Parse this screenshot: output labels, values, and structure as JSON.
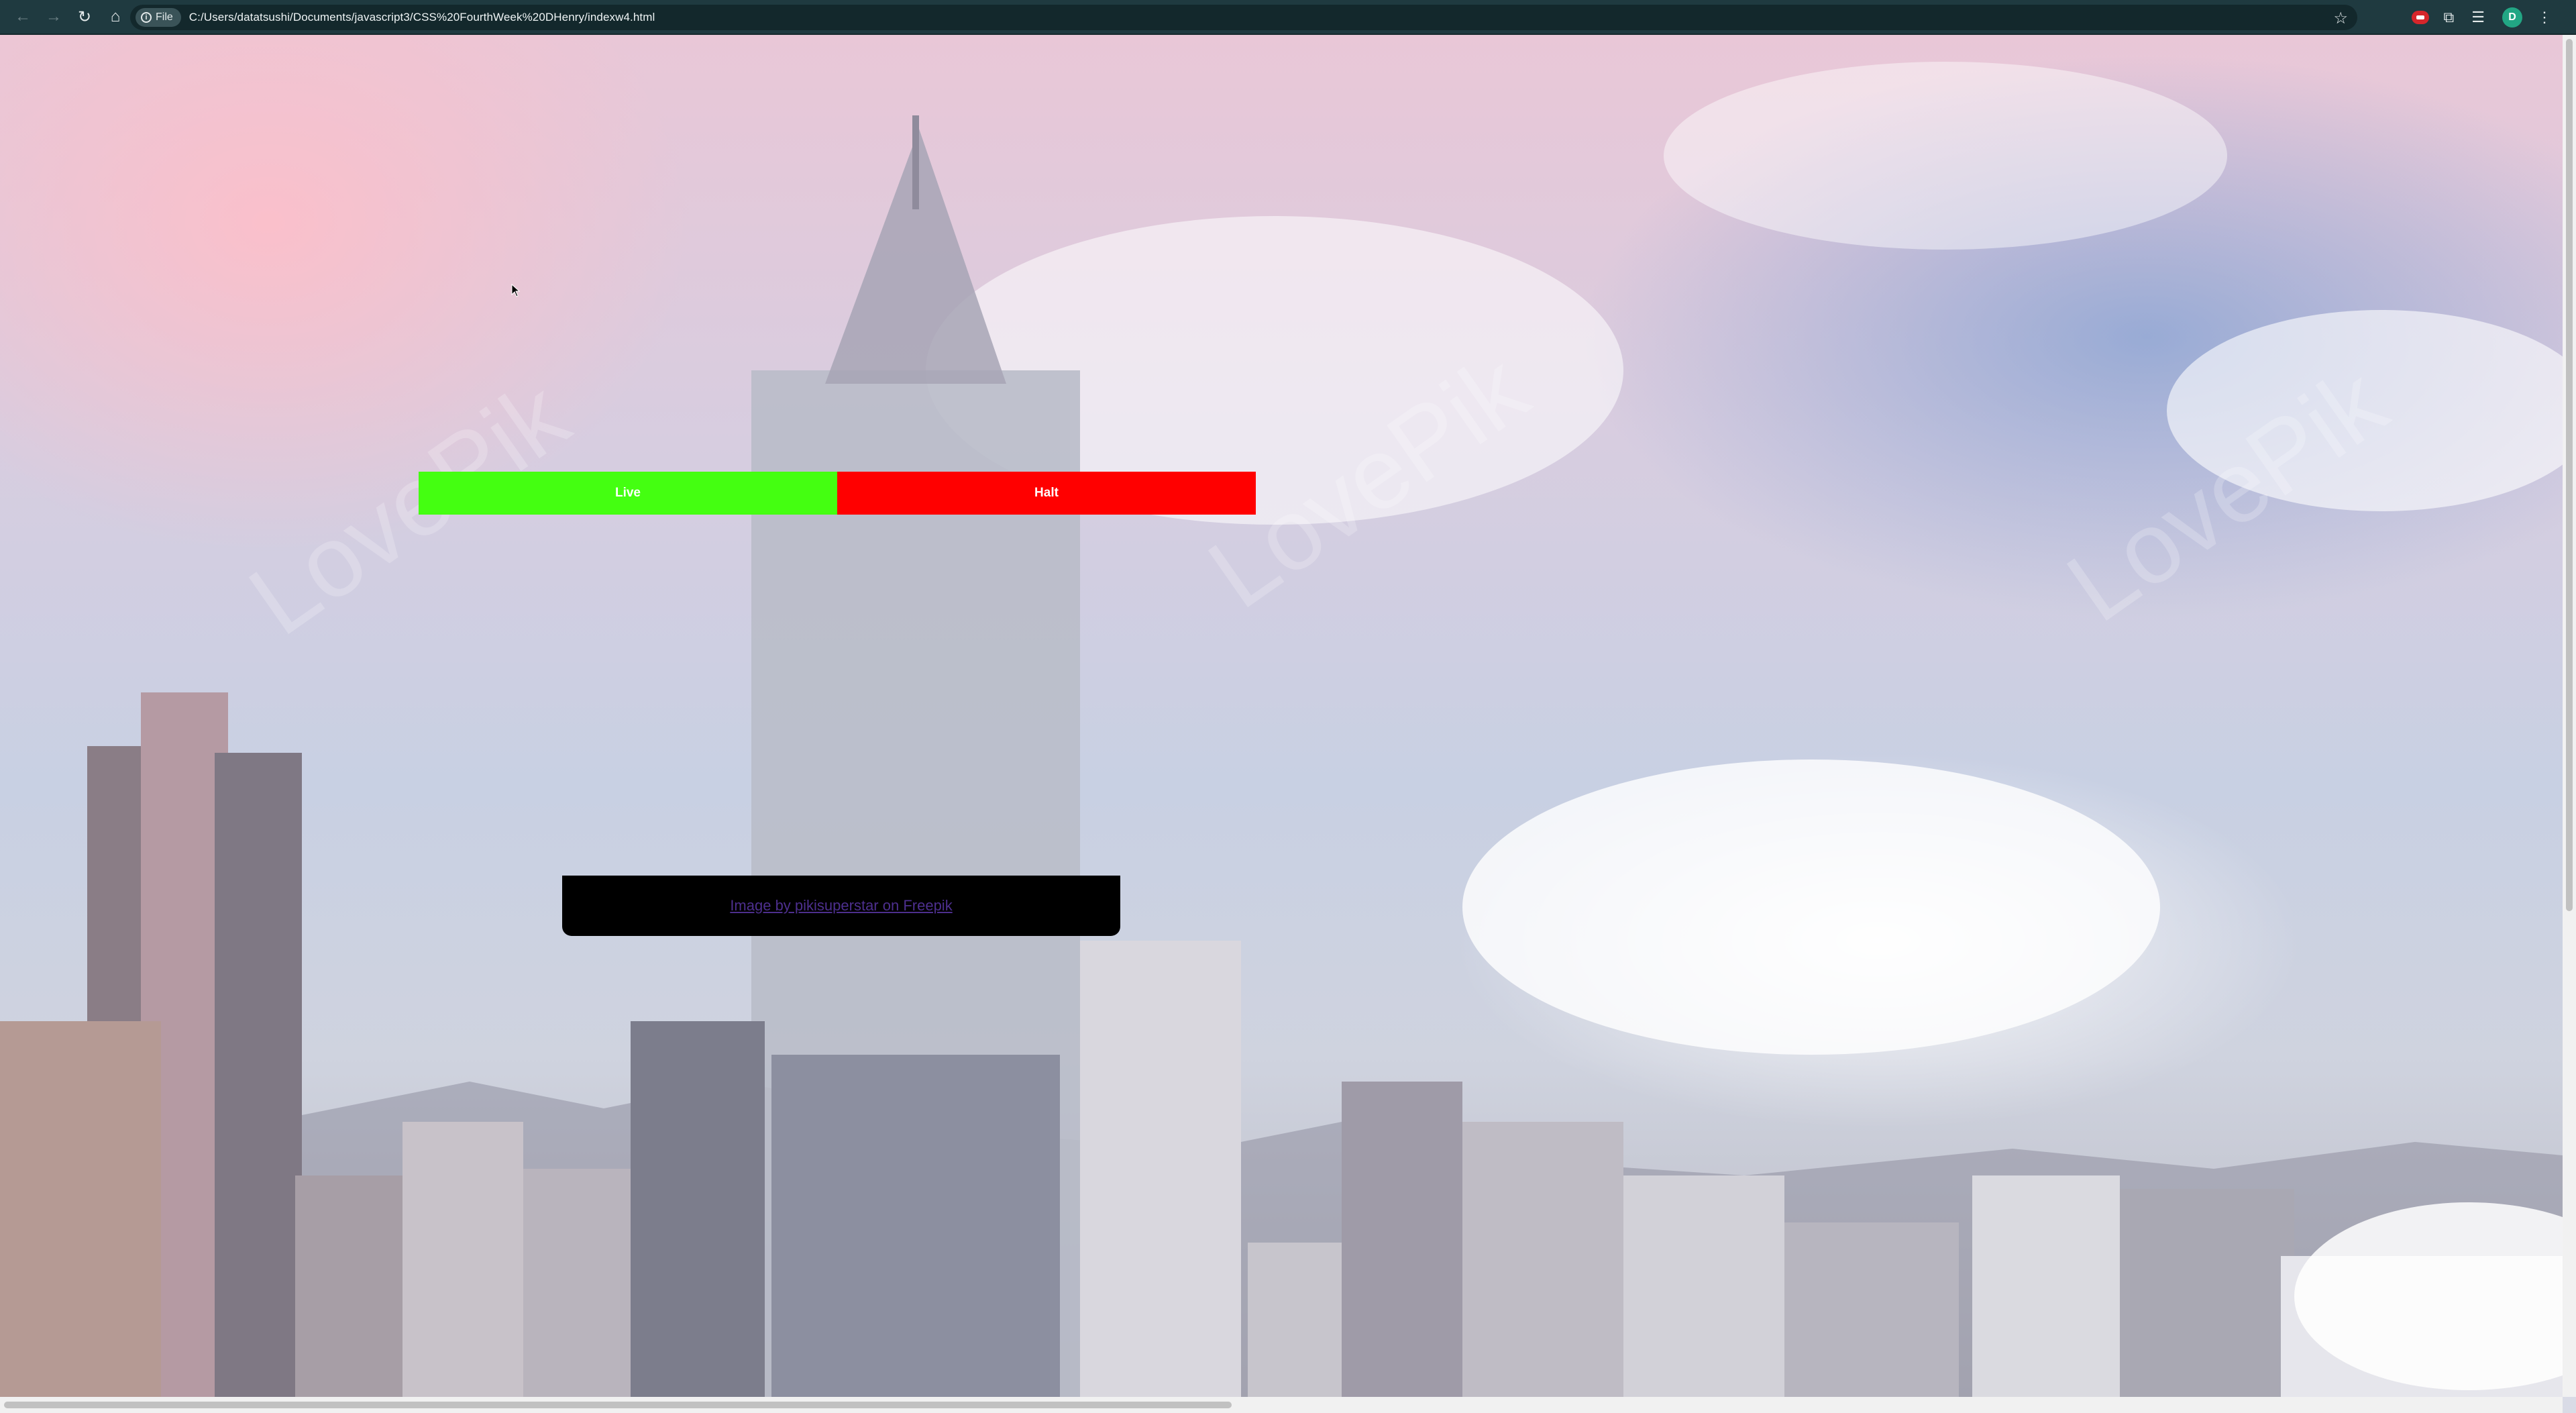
{
  "browser": {
    "back_icon": "arrow-left-icon",
    "forward_icon": "arrow-right-icon",
    "reload_icon": "reload-icon",
    "home_icon": "home-icon",
    "file_chip_label": "File",
    "url": "C:/Users/datatsushi/Documents/javascript3/CSS%20FourthWeek%20DHenry/indexw4.html",
    "avatar_letter": "D"
  },
  "page": {
    "live_button_label": "Live",
    "halt_button_label": "Halt",
    "credit_link_text": "Image by pikisuperstar on Freepik",
    "colors": {
      "live": "#44ff11",
      "halt": "#ff0000",
      "credit_bg": "#000000",
      "credit_link": "#4d2f8e"
    }
  }
}
